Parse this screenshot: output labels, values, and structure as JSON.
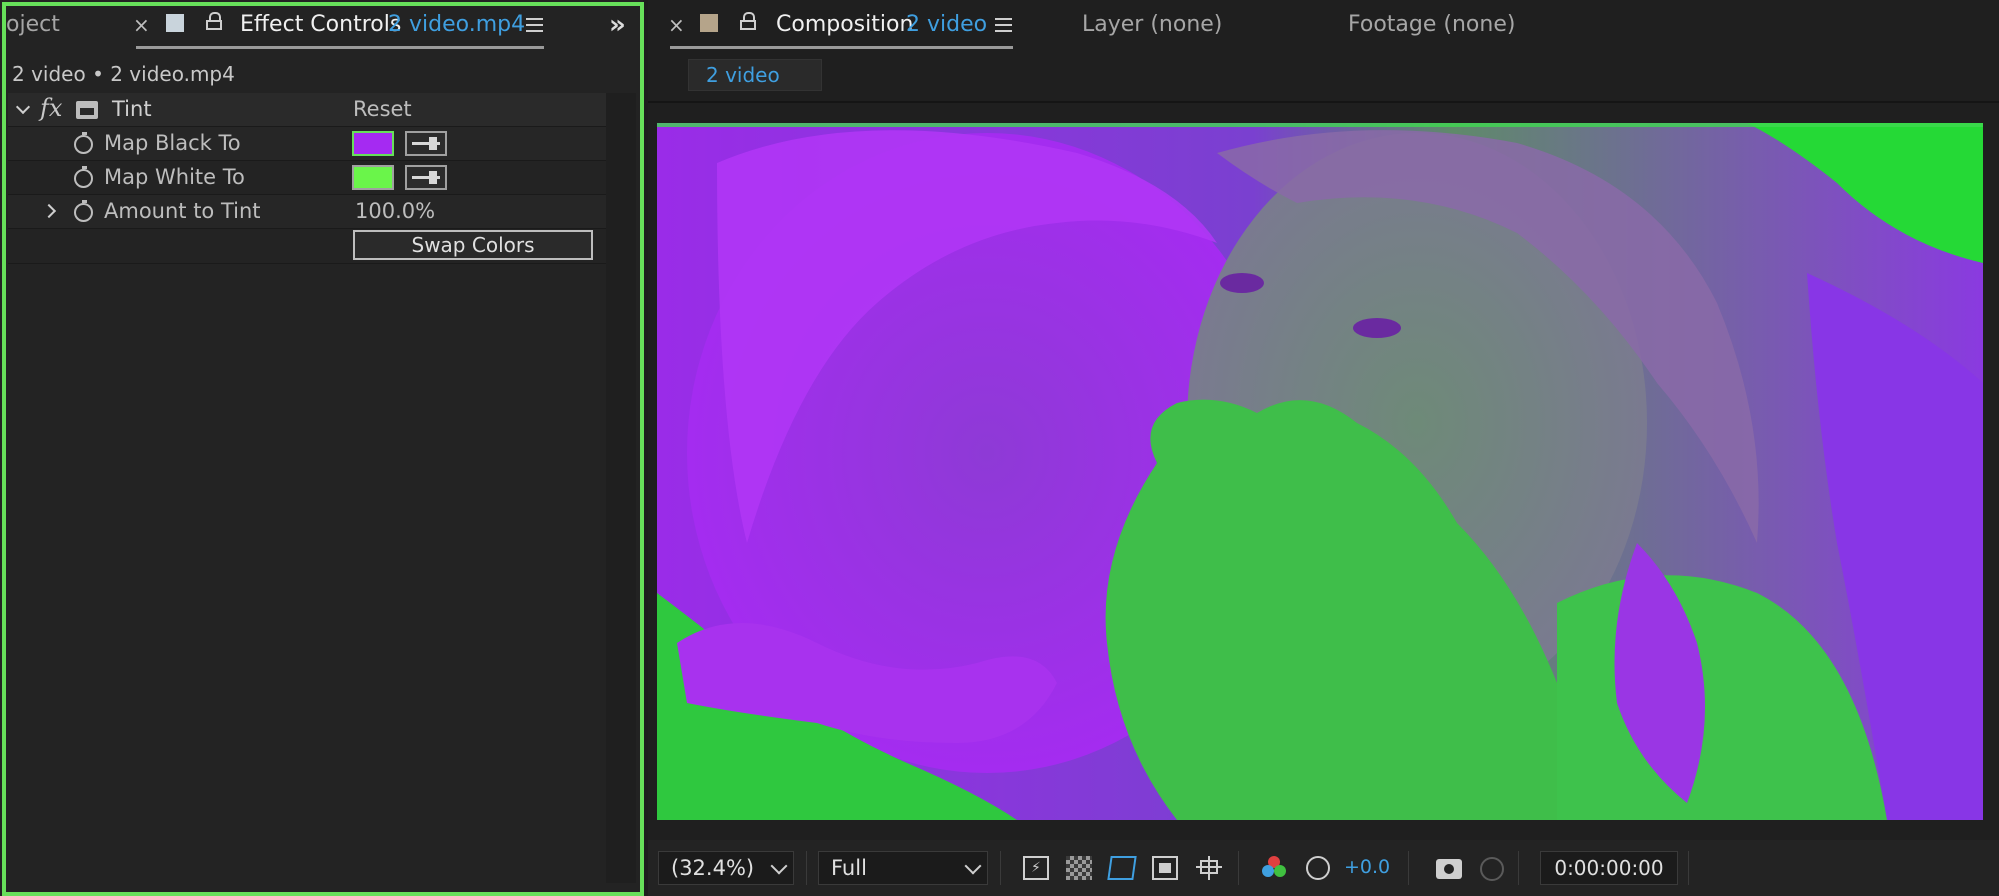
{
  "left_panel": {
    "project_tab": "oject",
    "effect_tab_label": "Effect Controls",
    "effect_tab_file": "2 video.mp4",
    "subtitle": "2 video • 2 video.mp4",
    "effect": {
      "fx_label": "fx",
      "name": "Tint",
      "reset_label": "Reset"
    },
    "properties": [
      {
        "label": "Map Black To",
        "color": "#a52af2"
      },
      {
        "label": "Map White To",
        "color": "#6af54a"
      },
      {
        "label": "Amount to Tint",
        "value": "100.0%"
      }
    ],
    "swap_button": "Swap Colors"
  },
  "right_panel": {
    "composition_tab_label": "Composition",
    "composition_tab_name": "2 video",
    "layer_tab": "Layer (none)",
    "footage_tab": "Footage (none)",
    "sub_tab": "2 video"
  },
  "bottom_bar": {
    "zoom": "(32.4%)",
    "resolution": "Full",
    "exposure": "+0.0",
    "timecode": "0:00:00:00"
  },
  "colors": {
    "panel_highlight": "#67e05a",
    "accent_blue": "#3f9fe0",
    "tint_black": "#a52af2",
    "tint_white": "#6af54a"
  }
}
